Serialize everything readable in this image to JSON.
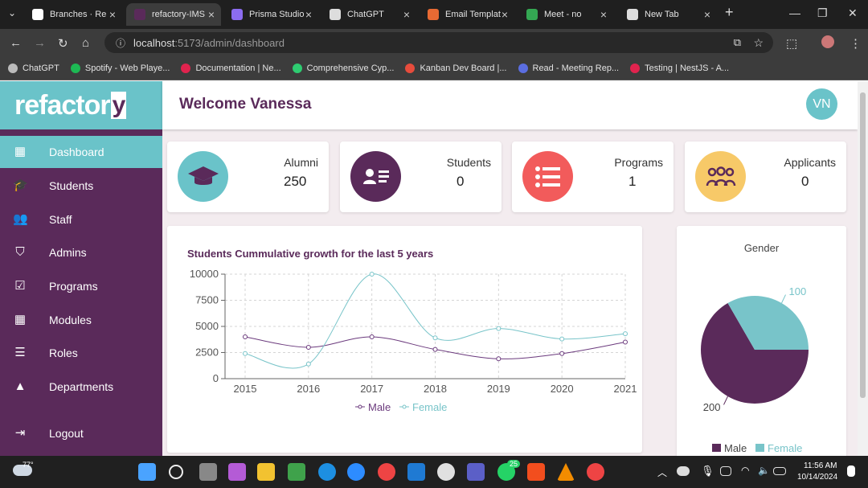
{
  "browser": {
    "tabs": [
      {
        "title": "Branches · Re",
        "color": "#ffffff"
      },
      {
        "title": "refactory-IMS",
        "color": "#5a2a5a"
      },
      {
        "title": "Prisma Studio",
        "color": "#8c6cf0"
      },
      {
        "title": "ChatGPT",
        "color": "#dddddd"
      },
      {
        "title": "Email Templat",
        "color": "#e86a33"
      },
      {
        "title": "Meet - no",
        "color": "#34a853"
      },
      {
        "title": "New Tab",
        "color": "#dddddd"
      }
    ],
    "url_host": "localhost",
    "url_path": ":5173/admin/dashboard",
    "bookmarks": [
      {
        "label": "ChatGPT",
        "color": "#bbbbbb"
      },
      {
        "label": "Spotify - Web Playe...",
        "color": "#1db954"
      },
      {
        "label": "Documentation | Ne...",
        "color": "#e0234e"
      },
      {
        "label": "Comprehensive Cyp...",
        "color": "#2ecc71"
      },
      {
        "label": "Kanban Dev Board |...",
        "color": "#e74c3c"
      },
      {
        "label": "Read - Meeting Rep...",
        "color": "#5b6ee1"
      },
      {
        "label": "Testing | NestJS - A...",
        "color": "#e0234e"
      }
    ]
  },
  "app": {
    "brand": "refactor",
    "brand_tail": "y",
    "welcome": "Welcome Vanessa",
    "avatar_initials": "VN",
    "sidebar": [
      {
        "label": "Dashboard",
        "icon": "dashboard-icon",
        "glyph": "▦"
      },
      {
        "label": "Students",
        "icon": "graduation-cap-icon",
        "glyph": "🎓"
      },
      {
        "label": "Staff",
        "icon": "people-icon",
        "glyph": "👥"
      },
      {
        "label": "Admins",
        "icon": "shield-user-icon",
        "glyph": "⛉"
      },
      {
        "label": "Programs",
        "icon": "checklist-icon",
        "glyph": "☑"
      },
      {
        "label": "Modules",
        "icon": "grid-icon",
        "glyph": "▦"
      },
      {
        "label": "Roles",
        "icon": "list-icon",
        "glyph": "☰"
      },
      {
        "label": "Departments",
        "icon": "shapes-icon",
        "glyph": "▲"
      }
    ],
    "logout": "Logout",
    "stats": [
      {
        "label": "Alumni",
        "value": "250",
        "color": "#6ac3c9",
        "icon": "graduation-cap-icon"
      },
      {
        "label": "Students",
        "value": "0",
        "color": "#5a2a5a",
        "icon": "id-card-icon"
      },
      {
        "label": "Programs",
        "value": "1",
        "color": "#f25b5b",
        "icon": "list-icon"
      },
      {
        "label": "Applicants",
        "value": "0",
        "color": "#f7c968",
        "icon": "group-icon"
      }
    ]
  },
  "chart_data": [
    {
      "type": "line",
      "title": "Students Cummulative growth for the last 5 years",
      "categories": [
        "2015",
        "2016",
        "2017",
        "2018",
        "2019",
        "2020",
        "2021"
      ],
      "series": [
        {
          "name": "Male",
          "color": "#6b3a7d",
          "values": [
            4000,
            3000,
            4000,
            2800,
            1900,
            2400,
            3500
          ]
        },
        {
          "name": "Female",
          "color": "#78c4c9",
          "values": [
            2400,
            1400,
            10000,
            3900,
            4800,
            3800,
            4300
          ]
        }
      ],
      "ylim": [
        0,
        10000
      ],
      "yticks": [
        "0",
        "2500",
        "5000",
        "7500",
        "10000"
      ],
      "grid": true,
      "legend": "bottom"
    },
    {
      "type": "pie",
      "title": "Gender",
      "categories": [
        "Male",
        "Female"
      ],
      "values": [
        200,
        100
      ],
      "labels": [
        "200",
        "100"
      ],
      "colors": [
        "#5a2a5a",
        "#78c4c9"
      ],
      "legend": "bottom"
    }
  ],
  "taskbar": {
    "weather": "77°",
    "time": "11:56 AM",
    "date": "10/14/2024",
    "badge_whatsapp": "25"
  }
}
